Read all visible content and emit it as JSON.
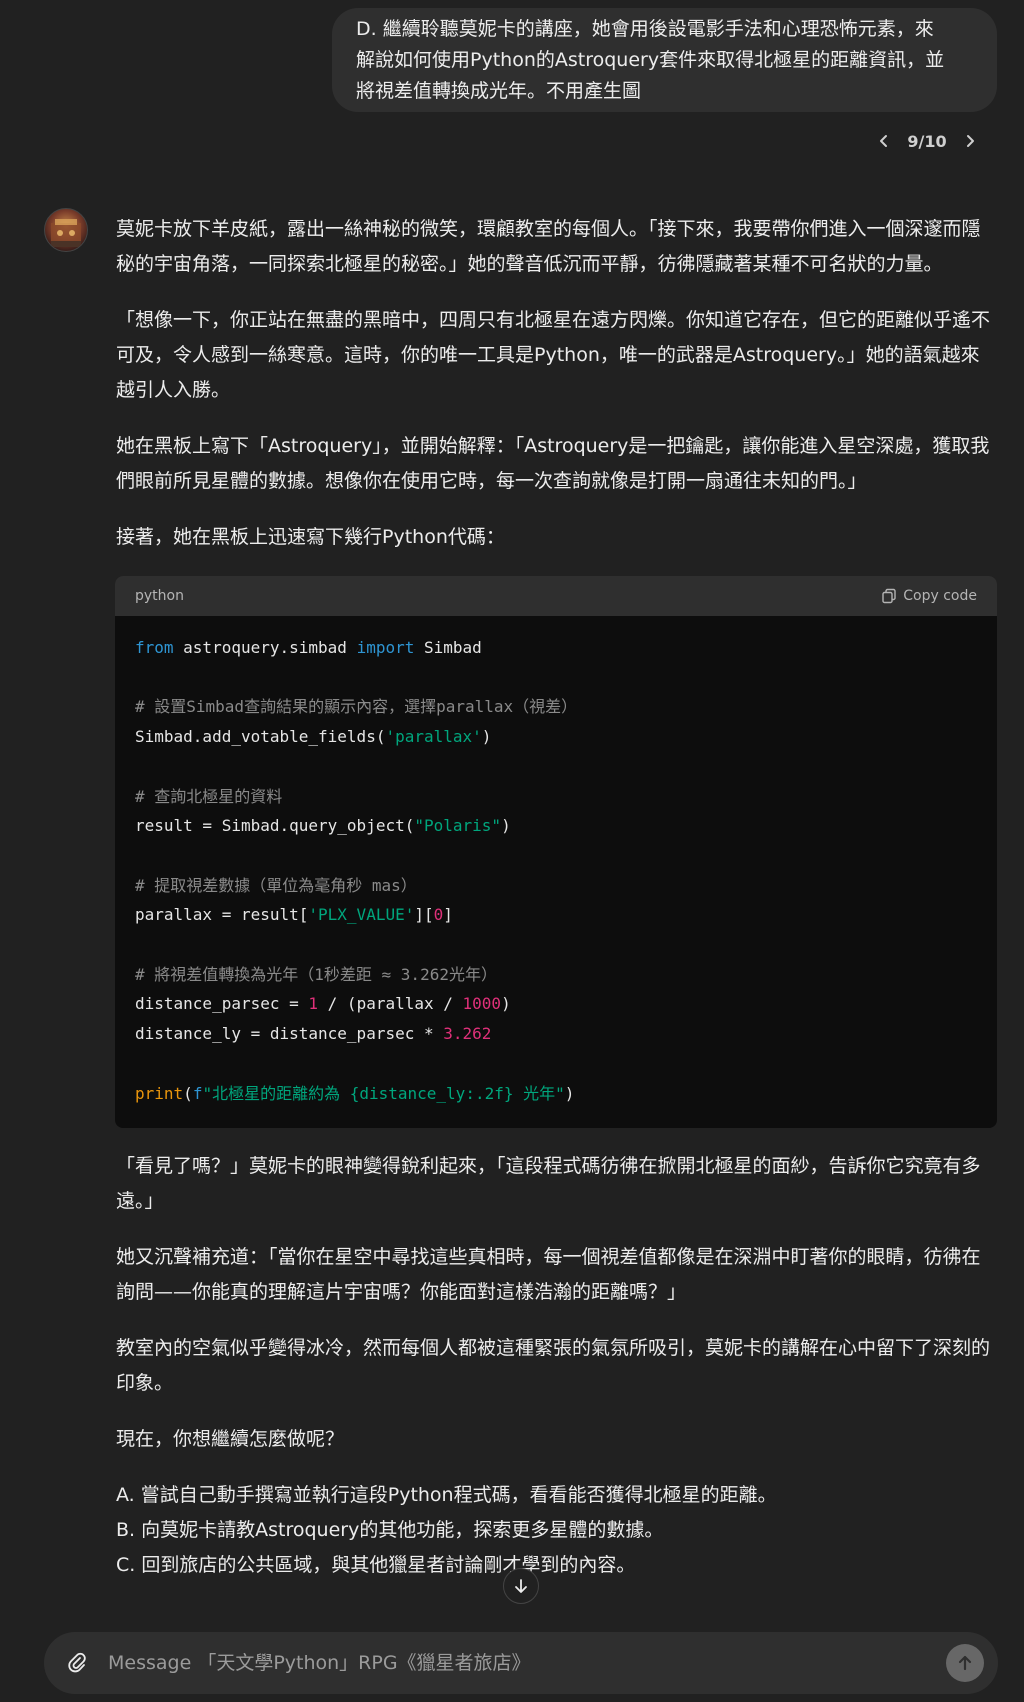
{
  "user_message": {
    "lines": [
      "D. 繼續聆聽莫妮卡的講座，她會用後設電影手法和心理恐怖元素，來",
      "解說如何使用Python的Astroquery套件來取得北極星的距離資訊，並",
      "將視差值轉換成光年。不用產生圖"
    ]
  },
  "pager": {
    "label": "9/10"
  },
  "assistant": {
    "paragraphs": [
      "莫妮卡放下羊皮紙，露出一絲神秘的微笑，環顧教室的每個人。「接下來，我要帶你們進入一個深邃而隱秘的宇宙角落，一同探索北極星的秘密。」她的聲音低沉而平靜，彷彿隱藏著某種不可名狀的力量。",
      "「想像一下，你正站在無盡的黑暗中，四周只有北極星在遠方閃爍。你知道它存在，但它的距離似乎遙不可及，令人感到一絲寒意。這時，你的唯一工具是Python，唯一的武器是Astroquery。」她的語氣越來越引人入勝。",
      "她在黑板上寫下「Astroquery」，並開始解釋：「Astroquery是一把鑰匙，讓你能進入星空深處，獲取我們眼前所見星體的數據。想像你在使用它時，每一次查詢就像是打開一扇通往未知的門。」",
      "接著，她在黑板上迅速寫下幾行Python代碼："
    ],
    "code": {
      "language": "python",
      "copy_label": "Copy code",
      "lines": [
        "from astroquery.simbad import Simbad",
        "",
        "# 設置Simbad查詢結果的顯示內容，選擇parallax（視差）",
        "Simbad.add_votable_fields('parallax')",
        "",
        "# 查詢北極星的資料",
        "result = Simbad.query_object(\"Polaris\")",
        "",
        "# 提取視差數據（單位為毫角秒 mas）",
        "parallax = result['PLX_VALUE'][0]",
        "",
        "# 將視差值轉換為光年（1秒差距 ≈ 3.262光年）",
        "distance_parsec = 1 / (parallax / 1000)",
        "distance_ly = distance_parsec * 3.262",
        "",
        "print(f\"北極星的距離約為 {distance_ly:.2f} 光年\")"
      ]
    },
    "paragraphs_after": [
      "「看見了嗎？」莫妮卡的眼神變得銳利起來，「這段程式碼彷彿在掀開北極星的面紗，告訴你它究竟有多遠。」",
      "她又沉聲補充道：「當你在星空中尋找這些真相時，每一個視差值都像是在深淵中盯著你的眼睛，彷彿在詢問——你能真的理解這片宇宙嗎？你能面對這樣浩瀚的距離嗎？」",
      "教室內的空氣似乎變得冰冷，然而每個人都被這種緊張的氣氛所吸引，莫妮卡的講解在心中留下了深刻的印象。",
      "現在，你想繼續怎麼做呢？"
    ],
    "options": [
      "A. 嘗試自己動手撰寫並執行這段Python程式碼，看看能否獲得北極星的距離。",
      "B. 向莫妮卡請教Astroquery的其他功能，探索更多星體的數據。",
      "C. 回到旅店的公共區域，與其他獵星者討論剛才學到的內容。"
    ]
  },
  "composer": {
    "placeholder": "Message 「天文學Python」RPG《獵星者旅店》"
  }
}
